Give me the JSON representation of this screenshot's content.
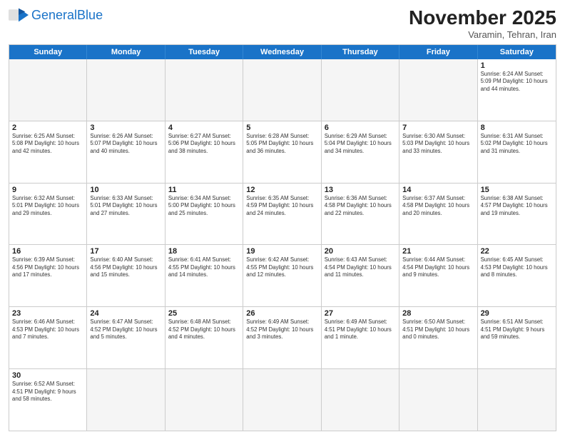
{
  "header": {
    "logo_general": "General",
    "logo_blue": "Blue",
    "month_title": "November 2025",
    "location": "Varamin, Tehran, Iran"
  },
  "weekdays": [
    "Sunday",
    "Monday",
    "Tuesday",
    "Wednesday",
    "Thursday",
    "Friday",
    "Saturday"
  ],
  "rows": [
    [
      {
        "day": "",
        "info": "",
        "empty": true
      },
      {
        "day": "",
        "info": "",
        "empty": true
      },
      {
        "day": "",
        "info": "",
        "empty": true
      },
      {
        "day": "",
        "info": "",
        "empty": true
      },
      {
        "day": "",
        "info": "",
        "empty": true
      },
      {
        "day": "",
        "info": "",
        "empty": true
      },
      {
        "day": "1",
        "info": "Sunrise: 6:24 AM\nSunset: 5:09 PM\nDaylight: 10 hours\nand 44 minutes."
      }
    ],
    [
      {
        "day": "2",
        "info": "Sunrise: 6:25 AM\nSunset: 5:08 PM\nDaylight: 10 hours\nand 42 minutes."
      },
      {
        "day": "3",
        "info": "Sunrise: 6:26 AM\nSunset: 5:07 PM\nDaylight: 10 hours\nand 40 minutes."
      },
      {
        "day": "4",
        "info": "Sunrise: 6:27 AM\nSunset: 5:06 PM\nDaylight: 10 hours\nand 38 minutes."
      },
      {
        "day": "5",
        "info": "Sunrise: 6:28 AM\nSunset: 5:05 PM\nDaylight: 10 hours\nand 36 minutes."
      },
      {
        "day": "6",
        "info": "Sunrise: 6:29 AM\nSunset: 5:04 PM\nDaylight: 10 hours\nand 34 minutes."
      },
      {
        "day": "7",
        "info": "Sunrise: 6:30 AM\nSunset: 5:03 PM\nDaylight: 10 hours\nand 33 minutes."
      },
      {
        "day": "8",
        "info": "Sunrise: 6:31 AM\nSunset: 5:02 PM\nDaylight: 10 hours\nand 31 minutes."
      }
    ],
    [
      {
        "day": "9",
        "info": "Sunrise: 6:32 AM\nSunset: 5:01 PM\nDaylight: 10 hours\nand 29 minutes."
      },
      {
        "day": "10",
        "info": "Sunrise: 6:33 AM\nSunset: 5:01 PM\nDaylight: 10 hours\nand 27 minutes."
      },
      {
        "day": "11",
        "info": "Sunrise: 6:34 AM\nSunset: 5:00 PM\nDaylight: 10 hours\nand 25 minutes."
      },
      {
        "day": "12",
        "info": "Sunrise: 6:35 AM\nSunset: 4:59 PM\nDaylight: 10 hours\nand 24 minutes."
      },
      {
        "day": "13",
        "info": "Sunrise: 6:36 AM\nSunset: 4:58 PM\nDaylight: 10 hours\nand 22 minutes."
      },
      {
        "day": "14",
        "info": "Sunrise: 6:37 AM\nSunset: 4:58 PM\nDaylight: 10 hours\nand 20 minutes."
      },
      {
        "day": "15",
        "info": "Sunrise: 6:38 AM\nSunset: 4:57 PM\nDaylight: 10 hours\nand 19 minutes."
      }
    ],
    [
      {
        "day": "16",
        "info": "Sunrise: 6:39 AM\nSunset: 4:56 PM\nDaylight: 10 hours\nand 17 minutes."
      },
      {
        "day": "17",
        "info": "Sunrise: 6:40 AM\nSunset: 4:56 PM\nDaylight: 10 hours\nand 15 minutes."
      },
      {
        "day": "18",
        "info": "Sunrise: 6:41 AM\nSunset: 4:55 PM\nDaylight: 10 hours\nand 14 minutes."
      },
      {
        "day": "19",
        "info": "Sunrise: 6:42 AM\nSunset: 4:55 PM\nDaylight: 10 hours\nand 12 minutes."
      },
      {
        "day": "20",
        "info": "Sunrise: 6:43 AM\nSunset: 4:54 PM\nDaylight: 10 hours\nand 11 minutes."
      },
      {
        "day": "21",
        "info": "Sunrise: 6:44 AM\nSunset: 4:54 PM\nDaylight: 10 hours\nand 9 minutes."
      },
      {
        "day": "22",
        "info": "Sunrise: 6:45 AM\nSunset: 4:53 PM\nDaylight: 10 hours\nand 8 minutes."
      }
    ],
    [
      {
        "day": "23",
        "info": "Sunrise: 6:46 AM\nSunset: 4:53 PM\nDaylight: 10 hours\nand 7 minutes."
      },
      {
        "day": "24",
        "info": "Sunrise: 6:47 AM\nSunset: 4:52 PM\nDaylight: 10 hours\nand 5 minutes."
      },
      {
        "day": "25",
        "info": "Sunrise: 6:48 AM\nSunset: 4:52 PM\nDaylight: 10 hours\nand 4 minutes."
      },
      {
        "day": "26",
        "info": "Sunrise: 6:49 AM\nSunset: 4:52 PM\nDaylight: 10 hours\nand 3 minutes."
      },
      {
        "day": "27",
        "info": "Sunrise: 6:49 AM\nSunset: 4:51 PM\nDaylight: 10 hours\nand 1 minute."
      },
      {
        "day": "28",
        "info": "Sunrise: 6:50 AM\nSunset: 4:51 PM\nDaylight: 10 hours\nand 0 minutes."
      },
      {
        "day": "29",
        "info": "Sunrise: 6:51 AM\nSunset: 4:51 PM\nDaylight: 9 hours\nand 59 minutes."
      }
    ],
    [
      {
        "day": "30",
        "info": "Sunrise: 6:52 AM\nSunset: 4:51 PM\nDaylight: 9 hours\nand 58 minutes."
      },
      {
        "day": "",
        "info": "",
        "empty": true
      },
      {
        "day": "",
        "info": "",
        "empty": true
      },
      {
        "day": "",
        "info": "",
        "empty": true
      },
      {
        "day": "",
        "info": "",
        "empty": true
      },
      {
        "day": "",
        "info": "",
        "empty": true
      },
      {
        "day": "",
        "info": "",
        "empty": true
      }
    ]
  ]
}
